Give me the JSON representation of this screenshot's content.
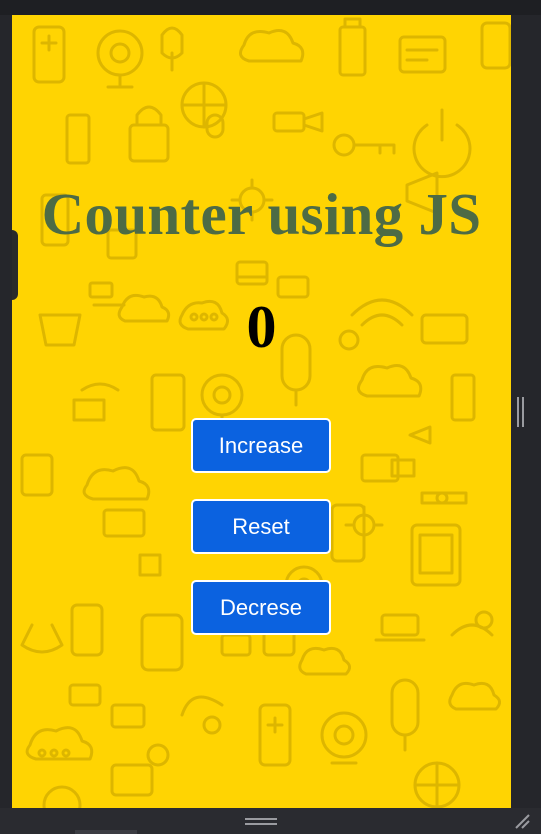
{
  "app": {
    "title": "Counter using JS",
    "count": "0"
  },
  "buttons": {
    "increase_label": "Increase",
    "reset_label": "Reset",
    "decrease_label": "Decrese"
  },
  "colors": {
    "background": "#ffd402",
    "pattern_stroke": "#d9b200",
    "title": "#4d6b45",
    "count": "#000000",
    "button_bg": "#0b62e0",
    "button_text": "#ffffff",
    "chrome": "#25262b"
  },
  "icons": {
    "background_pattern": "tech-gadget-doodle-pattern",
    "vertical_resize": "vertical-resize-handle-icon",
    "horizontal_resize": "horizontal-resize-handle-icon",
    "corner_resize": "corner-resize-grip-icon"
  }
}
